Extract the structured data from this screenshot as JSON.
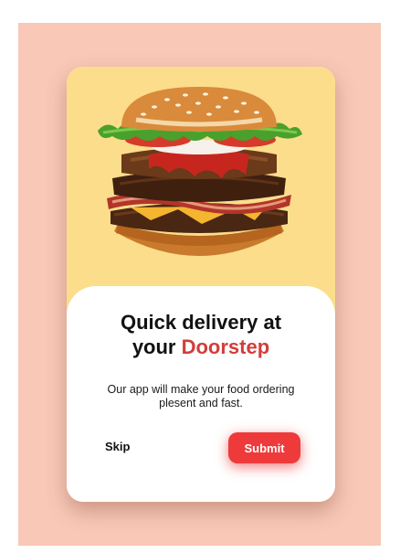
{
  "onboarding": {
    "title_line1": "Quick delivery at",
    "title_line2_prefix": "your ",
    "title_line2_accent": "Doorstep",
    "description": "Our app will make your food ordering plesent and fast.",
    "skip_label": "Skip",
    "submit_label": "Submit",
    "hero_image": "burger-image"
  },
  "colors": {
    "backdrop": "#f9c8b7",
    "hero_background": "#fbdd8b",
    "accent": "#d23d3b",
    "button": "#ee3a3a"
  }
}
